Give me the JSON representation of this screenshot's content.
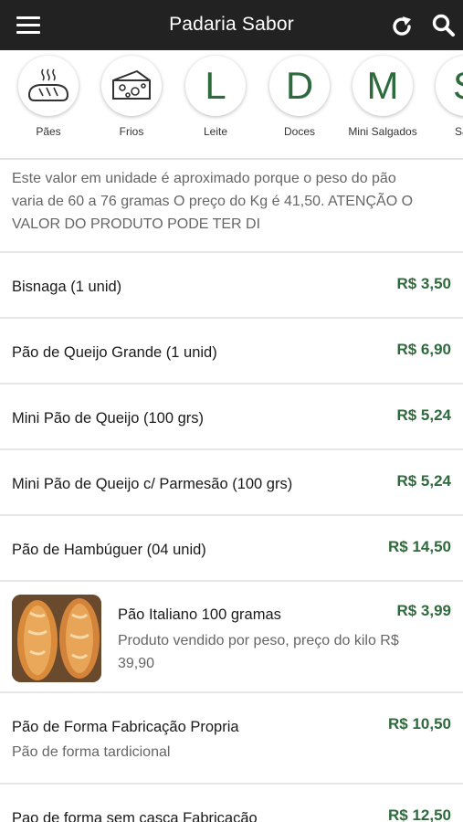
{
  "header": {
    "title": "Padaria Sabor",
    "menu_icon": "hamburger-icon",
    "refresh_icon": "refresh-icon",
    "search_icon": "search-icon"
  },
  "categories": [
    {
      "label": "Pães",
      "icon": "bread-icon"
    },
    {
      "label": "Frios",
      "icon": "cheese-icon"
    },
    {
      "label": "Leite",
      "letter": "L"
    },
    {
      "label": "Doces",
      "letter": "D"
    },
    {
      "label": "Mini Salgados",
      "letter": "M"
    },
    {
      "label": "Salg",
      "letter": "S"
    }
  ],
  "top_description": "Este valor em unidade é aproximado porque o peso do pão varia de 60 a 76 gramas O preço do Kg é 41,50. ATENÇÃO O VALOR DO PRODUTO PODE TER DI",
  "products": [
    {
      "name": "Bisnaga (1 unid)",
      "price": "R$ 3,50"
    },
    {
      "name": "Pão de Queijo Grande (1 unid)",
      "price": "R$ 6,90"
    },
    {
      "name": "Mini Pão de Queijo (100 grs)",
      "price": "R$ 5,24"
    },
    {
      "name": "Mini Pão de Queijo c/ Parmesão (100 grs)",
      "price": "R$ 5,24"
    },
    {
      "name": "Pão de Hambúguer (04 unid)",
      "price": "R$ 14,50"
    },
    {
      "name": "Pão Italiano 100 gramas",
      "price": "R$ 3,99",
      "description": "Produto vendido por peso, preço do kilo R$ 39,90"
    },
    {
      "name": "Pão de Forma Fabricação Propria",
      "price": "R$ 10,50",
      "description": "Pão de forma tardicional"
    },
    {
      "name": "Pao de forma sem casca Fabricação",
      "price": "R$ 12,50"
    }
  ],
  "colors": {
    "accent": "#2e6b3c",
    "header_bg": "#222222"
  }
}
